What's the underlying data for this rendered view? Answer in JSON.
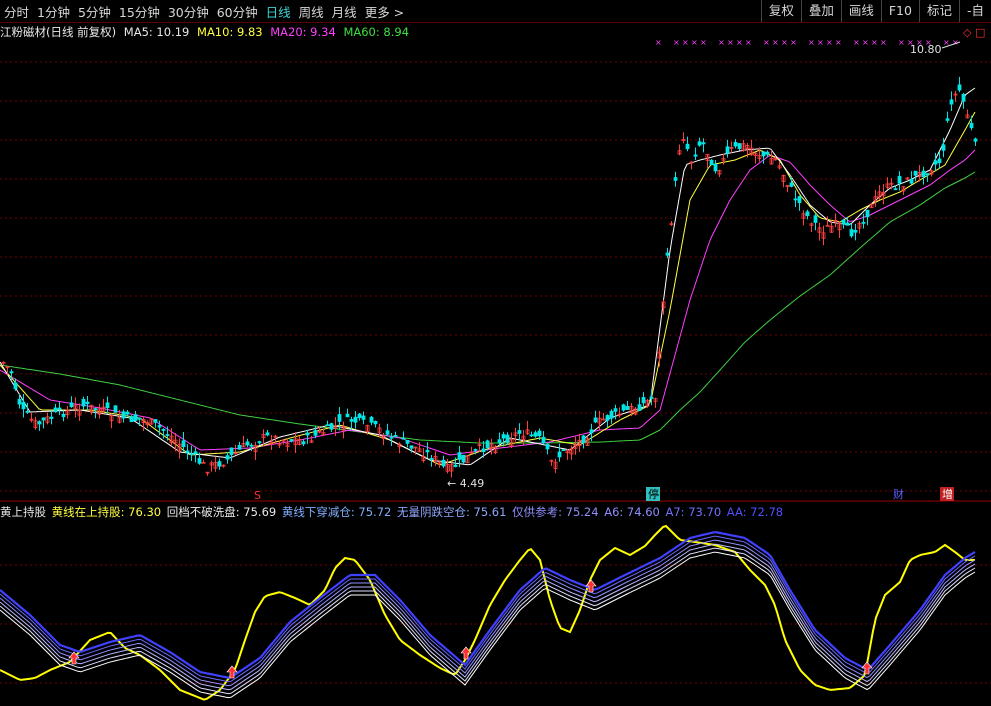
{
  "toolbar": {
    "periods": [
      "分时",
      "1分钟",
      "5分钟",
      "15分钟",
      "30分钟",
      "60分钟",
      "日线",
      "周线",
      "月线",
      "更多 >"
    ],
    "active_period": "日线",
    "right_buttons": [
      "复权",
      "叠加",
      "画线",
      "F10",
      "标记",
      "-自"
    ]
  },
  "main_header": {
    "title": "江粉磁材(日线 前复权)",
    "ma5": "MA5: 10.19",
    "ma10": "MA10: 9.83",
    "ma20": "MA20: 9.34",
    "ma60": "MA60: 8.94"
  },
  "sub_header": {
    "name": "黄上持股",
    "yellow_hold": "黄线在上持股: 76.30",
    "pullback": "回档不破洗盘: 75.69",
    "cross_down": "黄线下穿减仓: 75.72",
    "drop_clear": "无量阴跌空仓: 75.61",
    "ref": "仅供参考: 75.24",
    "a6": "A6: 74.60",
    "a7": "A7: 73.70",
    "aa": "AA: 72.78"
  },
  "annotations": {
    "high_label": "10.80",
    "low_label": "4.49",
    "marker_s": "S",
    "marker_stop": "停",
    "marker_fin": "财",
    "marker_add": "增",
    "marker_right": "◇ □"
  },
  "colors": {
    "up": "#ff4040",
    "down": "#00e5e5",
    "ma5": "#ffffff",
    "ma10": "#ffff40",
    "ma20": "#ff40ff",
    "ma60": "#40d040",
    "grid": "#700000",
    "yellow_line": "#ffff00",
    "band": "#5050ff"
  },
  "chart_data": {
    "type": "candlestick",
    "period": "daily",
    "high_marker": 10.8,
    "low_marker": 4.49,
    "ma": {
      "MA5": 10.19,
      "MA10": 9.83,
      "MA20": 9.34,
      "MA60": 8.94
    },
    "indicator": {
      "黄线在上持股": 76.3,
      "回档不破洗盘": 75.69,
      "黄线下穿减仓": 75.72,
      "无量阴跌空仓": 75.61,
      "仅供参考": 75.24,
      "A6": 74.6,
      "A7": 73.7,
      "AA": 72.78
    }
  }
}
